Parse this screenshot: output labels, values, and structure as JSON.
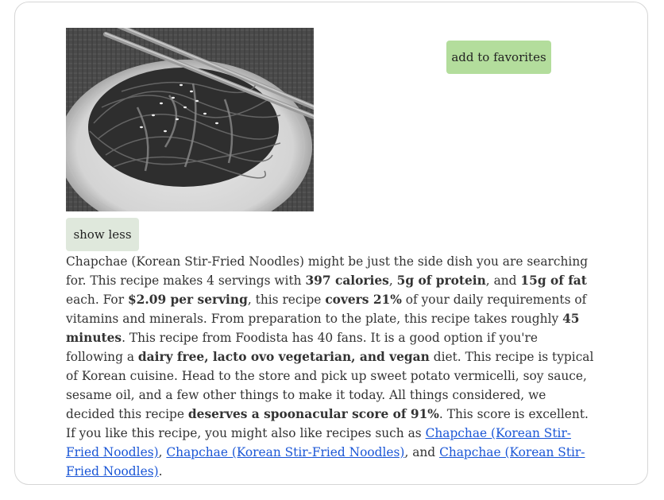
{
  "buttons": {
    "favorites_label": "add to favorites",
    "toggle_label": "show less"
  },
  "photo": {
    "icon": "noodle-dish-photo",
    "alt": "Chapchae (Korean Stir-Fried Noodles)"
  },
  "summary": {
    "s1": "Chapchae (Korean Stir-Fried Noodles) might be just the side dish you are searching for. This recipe makes 4 servings with ",
    "calories": "397 calories",
    "s2": ", ",
    "protein": "5g of protein",
    "s3": ", and ",
    "fat": "15g of fat",
    "s4": " each. For ",
    "cost": "$2.09 per serving",
    "s5": ", this recipe ",
    "covers": "covers 21%",
    "s6": " of your daily requirements of vitamins and minerals. From preparation to the plate, this recipe takes roughly ",
    "time": "45 minutes",
    "s7": ". This recipe from Foodista has 40 fans. It is a good option if you're following a ",
    "diets": "dairy free, lacto ovo vegetarian, and vegan",
    "s8": " diet. This recipe is typical of Korean cuisine. Head to the store and pick up sweet potato vermicelli, soy sauce, sesame oil, and a few other things to make it today. All things considered, we decided this recipe ",
    "score": "deserves a spoonacular score of 91%",
    "s9": ". This score is excellent. If you like this recipe, you might also like recipes such as ",
    "link1": "Chapchae (Korean Stir-Fried Noodles)",
    "s10": ", ",
    "link2": "Chapchae (Korean Stir-Fried Noodles)",
    "s11": ", and ",
    "link3": "Chapchae (Korean Stir-Fried Noodles)",
    "s12": "."
  },
  "colors": {
    "favorites_button": "#b3dd9c",
    "toggle_button": "#dfe8dc",
    "link": "#1a56d6",
    "card_border": "#d6d6d6"
  }
}
